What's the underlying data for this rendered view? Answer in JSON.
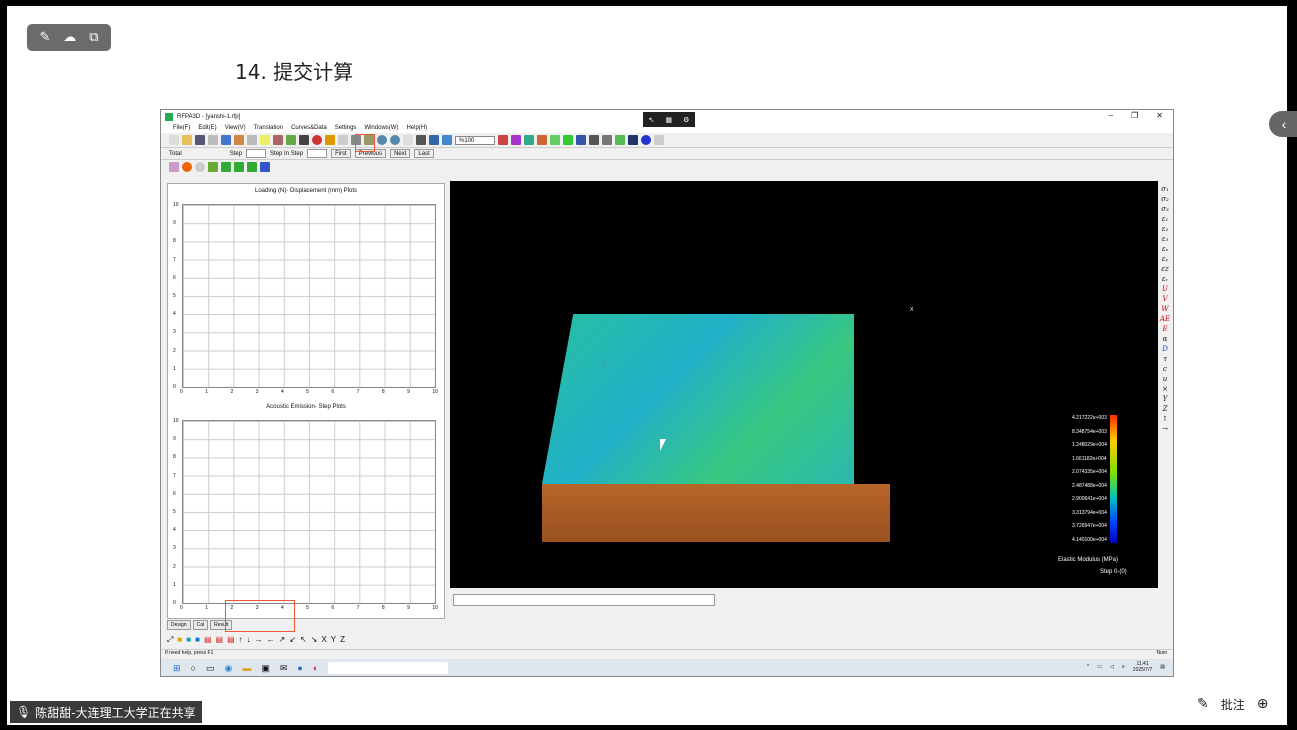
{
  "top_icons": [
    "pen-off-icon",
    "cloud-icon",
    "share-screen-icon"
  ],
  "slide_title": "14. 提交计算",
  "share_banner": {
    "text": "陈甜甜-大连理工大学正在共享"
  },
  "annotate": {
    "label": "批注"
  },
  "app": {
    "title": "RFPA3D - [yanshi-1.rfp]",
    "recording_icons": [
      "pointer-icon",
      "grid-icon",
      "settings-icon"
    ],
    "menu": [
      "File(F)",
      "Edit(E)",
      "View(V)",
      "Translation",
      "Curves&Data",
      "Settings",
      "Windows(W)",
      "Help(H)"
    ],
    "zoom": "%100",
    "step_bar": {
      "total": "Total",
      "step": "Step",
      "step_in_step": "Step In Step",
      "first": "First",
      "previous": "Previous",
      "next": "Next",
      "last": "Last"
    },
    "plot1": {
      "title": "Loading (N)- Displacement (mm) Plots",
      "x_ticks": [
        "0",
        "1",
        "2",
        "3",
        "4",
        "5",
        "6",
        "7",
        "8",
        "9",
        "10"
      ],
      "y_ticks": [
        "10",
        "9",
        "8",
        "7",
        "6",
        "5",
        "4",
        "3",
        "2",
        "1",
        "0"
      ]
    },
    "plot2": {
      "title": "Acoustic Emission- Step Plots",
      "x_ticks": [
        "0",
        "1",
        "2",
        "3",
        "4",
        "5",
        "6",
        "7",
        "8",
        "9",
        "10"
      ],
      "y_ticks": [
        "10",
        "9",
        "8",
        "7",
        "6",
        "5",
        "4",
        "3",
        "2",
        "1",
        "0"
      ]
    },
    "doc_tabs": [
      "Design",
      "Cal",
      "Result"
    ],
    "axis_label": "x",
    "legend": {
      "values": [
        "4.217222e+003",
        "8.348754e+003",
        "1.248029e+004",
        "1.661182e+004",
        "2.074335e+004",
        "2.487488e+004",
        "2.900641e+004",
        "3.313794e+004",
        "3.726947e+004",
        "4.140100e+004"
      ],
      "title": "Elastic Modulus (MPa)",
      "step": "Step 0-(0)"
    },
    "right_symbols": [
      "σ₁",
      "σ₂",
      "σ₃",
      "ε₁",
      "ε₂",
      "ε₃",
      "εₓ",
      "εᵧ",
      "εz",
      "εᵥ",
      "U",
      "V",
      "W",
      "AE",
      "E",
      "α",
      "D",
      "τ",
      "c",
      "u",
      "×",
      "Y",
      "Z",
      "↑",
      "→"
    ],
    "bottom_axes": [
      "X",
      "Y",
      "Z"
    ],
    "status_text": "If need help, press F1",
    "status_num": "Num",
    "taskbar_clock": {
      "time": "11:41",
      "date": "2025/7/7"
    }
  }
}
